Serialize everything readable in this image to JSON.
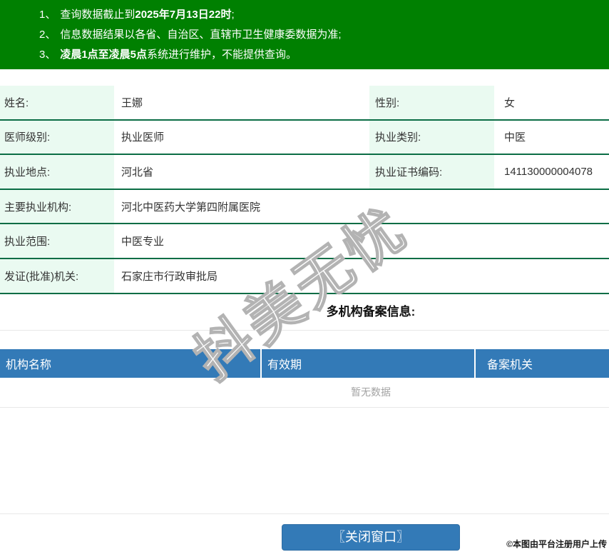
{
  "banner": {
    "notices": [
      {
        "num": "1、",
        "pre": "查询数据截止到",
        "bold": "2025年7月13日22时",
        "post": ";"
      },
      {
        "num": "2、",
        "pre": "信息数据结果以各省、自治区、直辖市卫生健康委数据为准;",
        "bold": "",
        "post": ""
      },
      {
        "num": "3、",
        "pre": "",
        "bold": "凌晨1点至凌晨5点",
        "post": "系统进行维护，不能提供查询。"
      }
    ]
  },
  "info": {
    "rows": [
      {
        "label": "姓名:",
        "value": "王娜",
        "label2": "性别:",
        "value2": "女"
      },
      {
        "label": "医师级别:",
        "value": "执业医师",
        "label2": "执业类别:",
        "value2": "中医"
      },
      {
        "label": "执业地点:",
        "value": "河北省",
        "label2": "执业证书编码:",
        "value2": "141130000004078"
      },
      {
        "label": "主要执业机构:",
        "value": "河北中医药大学第四附属医院"
      },
      {
        "label": "执业范围:",
        "value": "中医专业"
      },
      {
        "label": "发证(批准)机关:",
        "value": "石家庄市行政审批局"
      }
    ]
  },
  "section": {
    "title": "多机构备案信息:"
  },
  "record_table": {
    "columns": [
      "机构名称",
      "有效期",
      "备案机关"
    ],
    "empty_text": "暂无数据"
  },
  "close_button": {
    "label": "〖关闭窗口〗"
  },
  "watermarks": {
    "diagonal": "抖美无忧",
    "corner": "©本图由平台注册用户上传"
  },
  "colors": {
    "banner_green": "#008001",
    "row_line_green": "#0b6d45",
    "label_mint": "#eafaf1",
    "table_header_blue": "#337ab7",
    "button_blue": "#337ab7",
    "empty_text_gray": "#a3a3a3"
  }
}
